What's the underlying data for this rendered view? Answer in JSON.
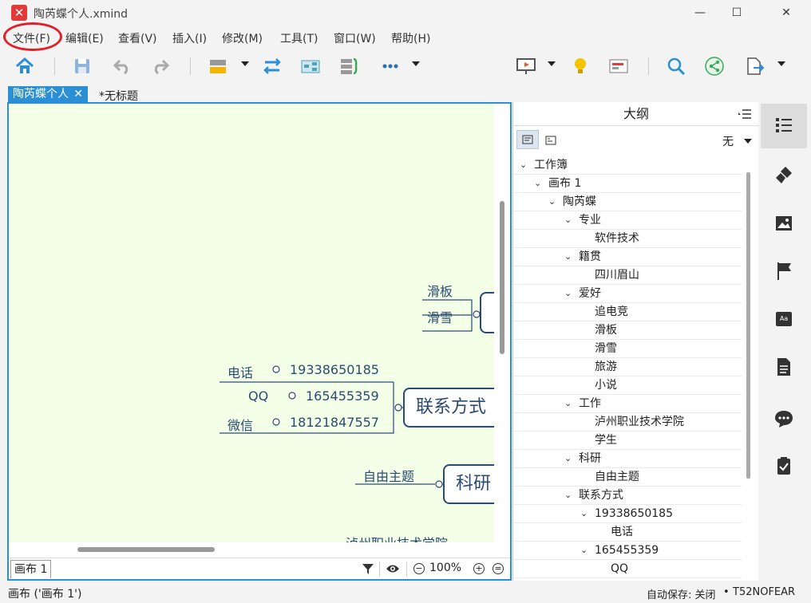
{
  "window": {
    "title": "陶芮蝶个人.xmind",
    "minimize_glyph": "—",
    "maximize_glyph": "☐",
    "close_glyph": "✕"
  },
  "menu": {
    "file": "文件(F)",
    "edit": "编辑(E)",
    "view": "查看(V)",
    "insert": "插入(I)",
    "modify": "修改(M)",
    "tools": "工具(T)",
    "window": "窗口(W)",
    "help": "帮助(H)"
  },
  "tabs": {
    "active": "陶芮蝶个人",
    "inactive": "*无标题",
    "close_glyph": "✕"
  },
  "canvas": {
    "branch_hobby": {
      "items": [
        "滑板",
        "滑雪"
      ]
    },
    "contact": {
      "topic": "联系方式",
      "rows": [
        {
          "label": "电话",
          "value": "19338650185"
        },
        {
          "label": "QQ",
          "value": "165455359"
        },
        {
          "label": "微信",
          "value": "18121847557"
        }
      ]
    },
    "research": {
      "topic": "科研",
      "child": "自由主题"
    },
    "partial_text": "泸州职业技术学院"
  },
  "canvas_footer": {
    "sheet_tab": "画布 1",
    "zoom": "100%"
  },
  "outline": {
    "title": "大纲",
    "filter_value": "无",
    "tree": [
      {
        "label": "工作簿",
        "level": 0,
        "expanded": true
      },
      {
        "label": "画布 1",
        "level": 1,
        "expanded": true
      },
      {
        "label": "陶芮蝶",
        "level": 2,
        "expanded": true
      },
      {
        "label": "专业",
        "level": 3,
        "expanded": true
      },
      {
        "label": "软件技术",
        "level": 4,
        "expanded": false
      },
      {
        "label": "籍贯",
        "level": 3,
        "expanded": true
      },
      {
        "label": "四川眉山",
        "level": 4,
        "expanded": false
      },
      {
        "label": "爱好",
        "level": 3,
        "expanded": true
      },
      {
        "label": "追电竞",
        "level": 4,
        "expanded": false
      },
      {
        "label": "滑板",
        "level": 4,
        "expanded": false
      },
      {
        "label": "滑雪",
        "level": 4,
        "expanded": false
      },
      {
        "label": "旅游",
        "level": 4,
        "expanded": false
      },
      {
        "label": "小说",
        "level": 4,
        "expanded": false
      },
      {
        "label": "工作",
        "level": 3,
        "expanded": true
      },
      {
        "label": "泸州职业技术学院",
        "level": 4,
        "expanded": false
      },
      {
        "label": "学生",
        "level": 4,
        "expanded": false
      },
      {
        "label": "科研",
        "level": 3,
        "expanded": true
      },
      {
        "label": "自由主题",
        "level": 4,
        "expanded": false
      },
      {
        "label": "联系方式",
        "level": 3,
        "expanded": true
      },
      {
        "label": "19338650185",
        "level": 4,
        "expanded": true
      },
      {
        "label": "电话",
        "level": 5,
        "expanded": false
      },
      {
        "label": "165455359",
        "level": 4,
        "expanded": true
      },
      {
        "label": "QQ",
        "level": 5,
        "expanded": false
      }
    ]
  },
  "status": {
    "left": "画布 ('画布 1')",
    "autosave": "自动保存: 关闭",
    "user": "T52NOFEAR"
  },
  "colors": {
    "accent": "#2b8fd6",
    "canvas_bg": "#f3ffe6",
    "topic_border": "#2b4a73",
    "annotation": "#e0202a"
  },
  "icons": {
    "toolbar": [
      "home-icon",
      "save-icon",
      "undo-icon",
      "redo-icon",
      "topic-style-icon",
      "relationship-icon",
      "structure-icon",
      "boundary-icon",
      "more-icon",
      "presentation-icon",
      "idea-icon",
      "gantt-icon",
      "search-icon",
      "share-icon",
      "export-icon"
    ],
    "sidebar": [
      "outline-icon",
      "format-icon",
      "image-icon",
      "marker-icon",
      "text-style-icon",
      "notes-icon",
      "comments-icon",
      "task-icon"
    ]
  }
}
